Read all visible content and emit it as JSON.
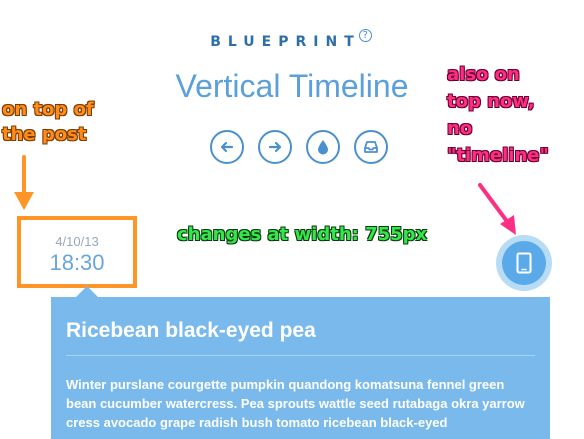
{
  "header": {
    "brand": "BLUEPRINT",
    "brand_badge": "?",
    "title": "Vertical Timeline"
  },
  "nav": {
    "buttons": [
      {
        "icon": "arrow-left-icon"
      },
      {
        "icon": "arrow-right-icon"
      },
      {
        "icon": "drop-icon"
      },
      {
        "icon": "inbox-icon"
      }
    ]
  },
  "annotations": {
    "orange": "on top of\nthe post",
    "pink": "also on\ntop now,\nno\n\"timeline\"",
    "green": "changes at width: 755px"
  },
  "post": {
    "date": "4/10/13",
    "time": "18:30",
    "icon": "tablet-icon",
    "title": "Ricebean black-eyed pea",
    "body": "Winter purslane courgette pumpkin quandong komatsuna fennel green bean cucumber watercress. Pea sprouts wattle seed rutabaga okra yarrow cress avocado grape radish bush tomato ricebean black-eyed"
  },
  "colors": {
    "accent": "#4a90cf",
    "title": "#5ba0da",
    "card": "#7ab9ec",
    "annotation_orange": "#ff8c1a",
    "annotation_pink": "#ff2e85",
    "annotation_green": "#35e64a"
  }
}
